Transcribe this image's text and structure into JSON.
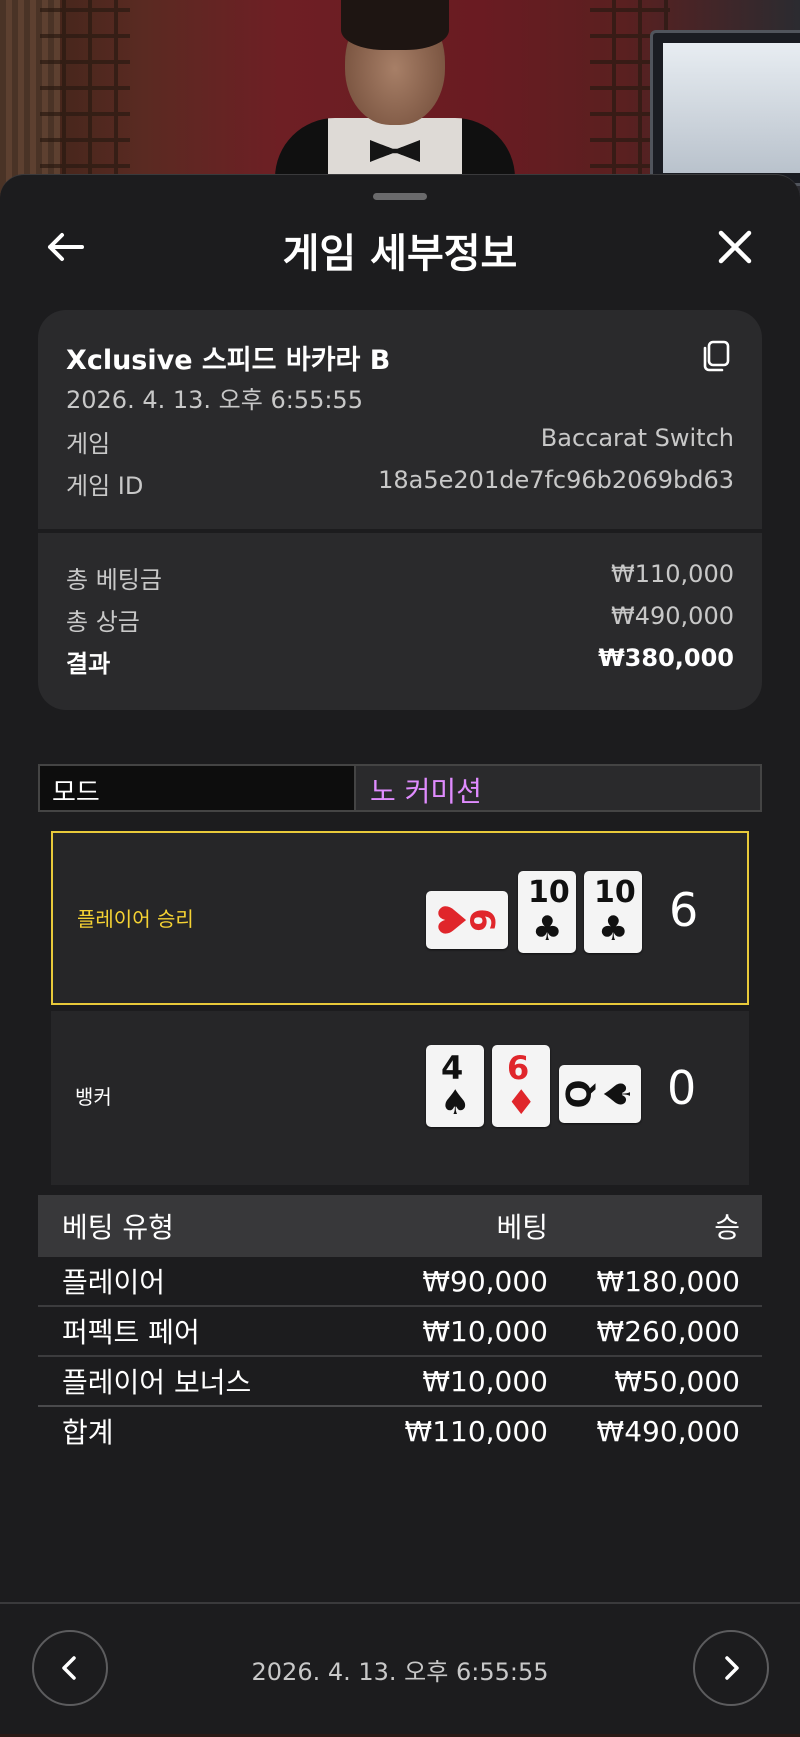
{
  "header": {
    "title": "게임 세부정보"
  },
  "summary": {
    "game_name": "Xclusive 스피드 바카라 B",
    "datetime": "2026. 4. 13. 오후 6:55:55",
    "game_label": "게임",
    "game_value": "Baccarat Switch",
    "game_id_label": "게임 ID",
    "game_id_value": "18a5e201de7fc96b2069bd63",
    "total_bet_label": "총 베팅금",
    "total_bet_value": "₩110,000",
    "total_prize_label": "총 상금",
    "total_prize_value": "₩490,000",
    "result_label": "결과",
    "result_value": "₩380,000"
  },
  "mode": {
    "label": "모드",
    "value": "노 커미션",
    "value_color": "#e08cff"
  },
  "outcome": {
    "player": {
      "label": "플레이어 승리",
      "total": "6",
      "cards": [
        {
          "rank": "9",
          "suit": "♥",
          "color": "red",
          "orientation": "sideways"
        },
        {
          "rank": "10",
          "suit": "♣",
          "color": "black",
          "orientation": "upright"
        },
        {
          "rank": "10",
          "suit": "♣",
          "color": "black",
          "orientation": "upright"
        }
      ]
    },
    "banker": {
      "label": "뱅커",
      "total": "0",
      "cards": [
        {
          "rank": "4",
          "suit": "♠",
          "color": "black",
          "orientation": "upright"
        },
        {
          "rank": "6",
          "suit": "♦",
          "color": "red",
          "orientation": "upright"
        },
        {
          "rank": "Q",
          "suit": "♠",
          "color": "black",
          "orientation": "sideways"
        }
      ]
    },
    "win_border_color": "#e8c93a"
  },
  "bets": {
    "headers": {
      "type": "베팅 유형",
      "bet": "베팅",
      "win": "승"
    },
    "rows": [
      {
        "type": "플레이어",
        "bet": "₩90,000",
        "win": "₩180,000"
      },
      {
        "type": "퍼펙트 페어",
        "bet": "₩10,000",
        "win": "₩260,000"
      },
      {
        "type": "플레이어 보너스",
        "bet": "₩10,000",
        "win": "₩50,000"
      }
    ],
    "total": {
      "type": "합계",
      "bet": "₩110,000",
      "win": "₩490,000"
    }
  },
  "footer": {
    "datetime": "2026. 4. 13. 오후 6:55:55"
  },
  "icons": {
    "back": "arrow-left-icon",
    "close": "close-icon",
    "copy": "copy-icon",
    "prev": "chevron-left-icon",
    "next": "chevron-right-icon"
  }
}
